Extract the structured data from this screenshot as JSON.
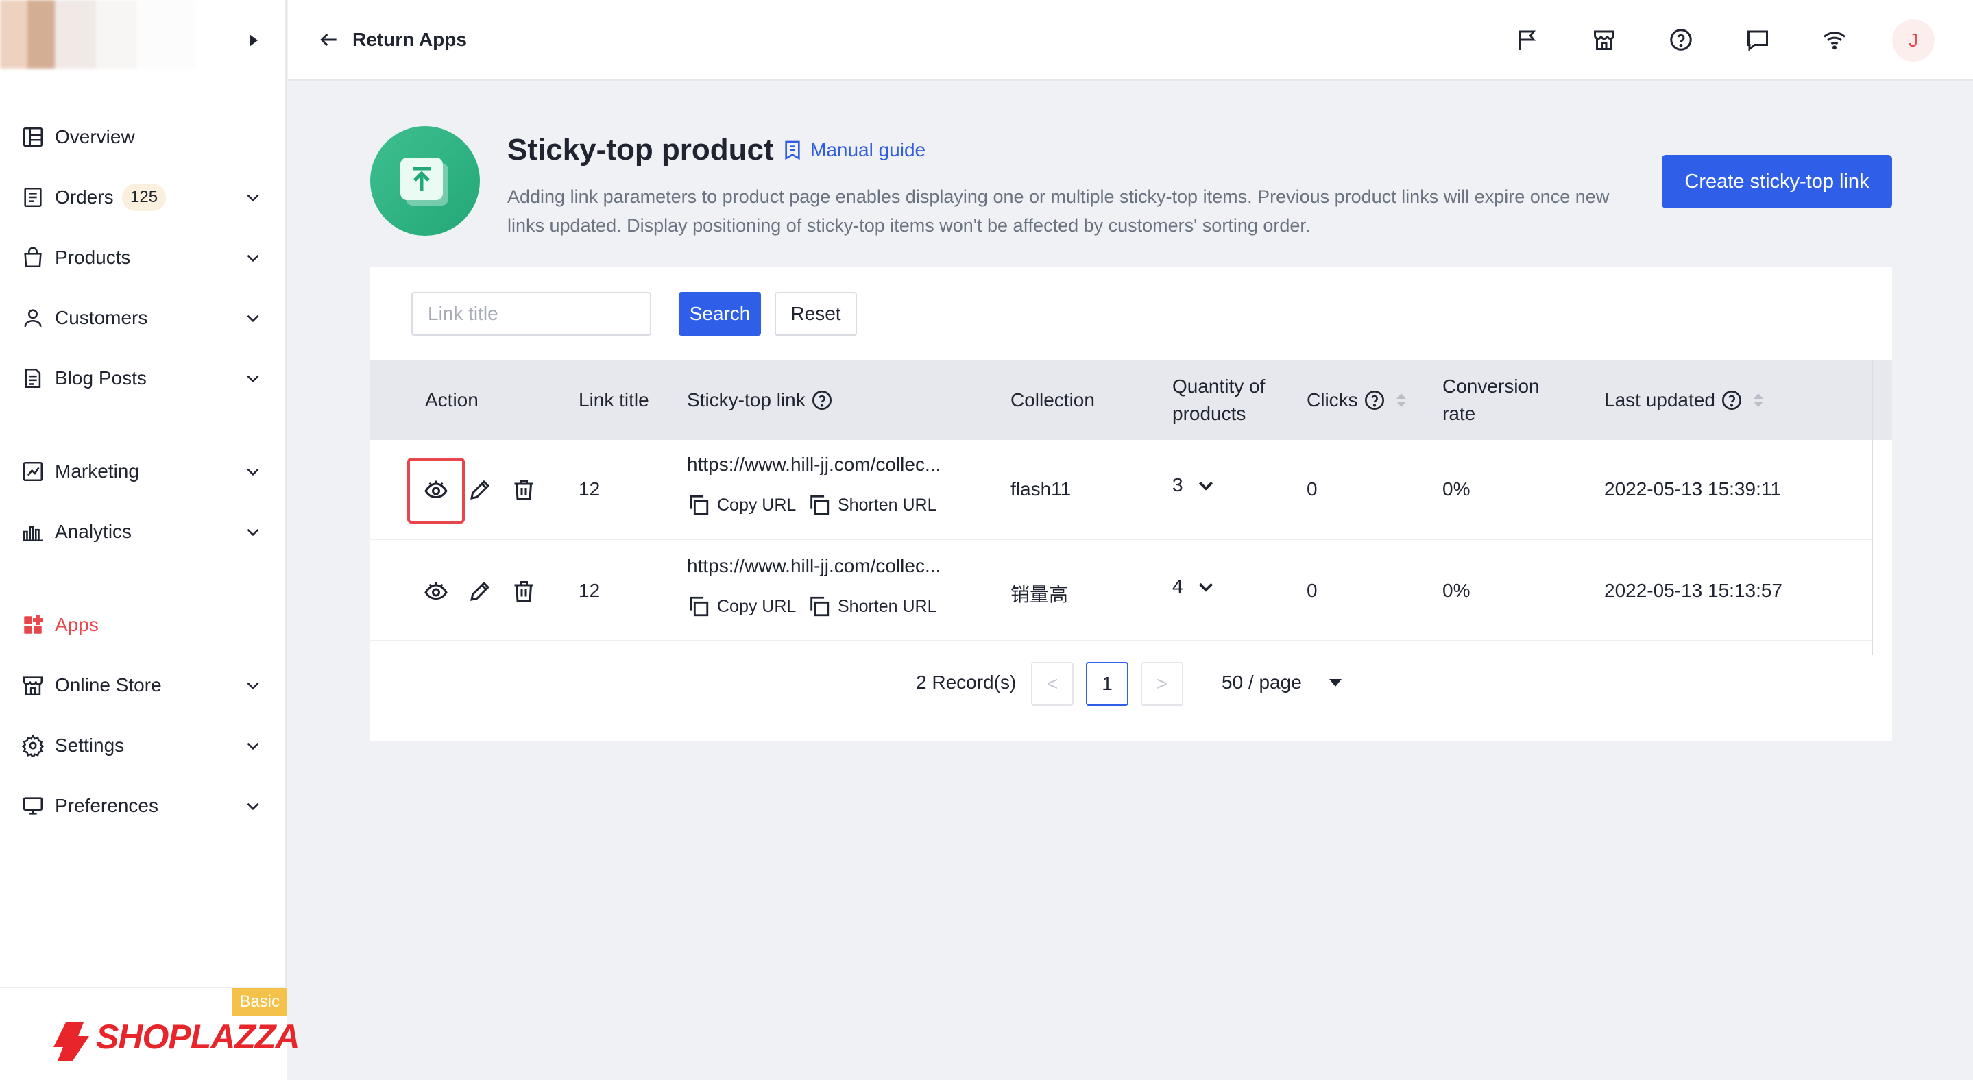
{
  "sidebar": {
    "items": [
      {
        "label": "Overview",
        "icon": "overview-icon",
        "chevron": false
      },
      {
        "label": "Orders",
        "icon": "orders-icon",
        "chevron": true,
        "badge": "125"
      },
      {
        "label": "Products",
        "icon": "products-icon",
        "chevron": true
      },
      {
        "label": "Customers",
        "icon": "customers-icon",
        "chevron": true
      },
      {
        "label": "Blog Posts",
        "icon": "blog-icon",
        "chevron": true
      },
      {
        "label": "Marketing",
        "icon": "marketing-icon",
        "chevron": true
      },
      {
        "label": "Analytics",
        "icon": "analytics-icon",
        "chevron": true
      },
      {
        "label": "Apps",
        "icon": "apps-icon",
        "chevron": false,
        "active": true
      },
      {
        "label": "Online Store",
        "icon": "online-store-icon",
        "chevron": true
      },
      {
        "label": "Settings",
        "icon": "settings-icon",
        "chevron": true
      },
      {
        "label": "Preferences",
        "icon": "preferences-icon",
        "chevron": true
      }
    ],
    "plan": "Basic",
    "brand": "SHOPLAZZA"
  },
  "topbar": {
    "back_label": "Return Apps",
    "icons": [
      "flag-icon",
      "store-icon",
      "help-icon",
      "message-icon",
      "wifi-icon"
    ],
    "avatar_initial": "J"
  },
  "app": {
    "title": "Sticky-top product",
    "guide_label": "Manual guide",
    "description": "Adding link parameters to product page enables displaying one or multiple sticky-top items. Previous product links will expire once new links updated. Display positioning of sticky-top items won't be affected by customers' sorting order.",
    "create_label": "Create sticky-top link"
  },
  "filter": {
    "placeholder": "Link title",
    "search_label": "Search",
    "reset_label": "Reset"
  },
  "table": {
    "headers": {
      "action": "Action",
      "link_title": "Link title",
      "sticky_link": "Sticky-top link",
      "collection": "Collection",
      "quantity": [
        "Quantity of",
        "products"
      ],
      "clicks": "Clicks",
      "conversion": [
        "Conversion",
        "rate"
      ],
      "last_updated": "Last updated"
    },
    "copy_label": "Copy URL",
    "shorten_label": "Shorten URL",
    "rows": [
      {
        "link_title": "12",
        "url": "https://www.hill-jj.com/collec...",
        "collection": "flash11",
        "quantity": "3",
        "clicks": "0",
        "conversion": "0%",
        "updated": "2022-05-13 15:39:11"
      },
      {
        "link_title": "12",
        "url": "https://www.hill-jj.com/collec...",
        "collection": "销量高",
        "quantity": "4",
        "clicks": "0",
        "conversion": "0%",
        "updated": "2022-05-13 15:13:57"
      }
    ]
  },
  "pagination": {
    "total": "2 Record(s)",
    "prev": "<",
    "current": "1",
    "next": ">",
    "page_size": "50 / page"
  },
  "colors": {
    "accent": "#2f5fe8",
    "active_nav": "#e8464a",
    "brand": "#e8252a",
    "app_logo": "#3fbf8f"
  }
}
